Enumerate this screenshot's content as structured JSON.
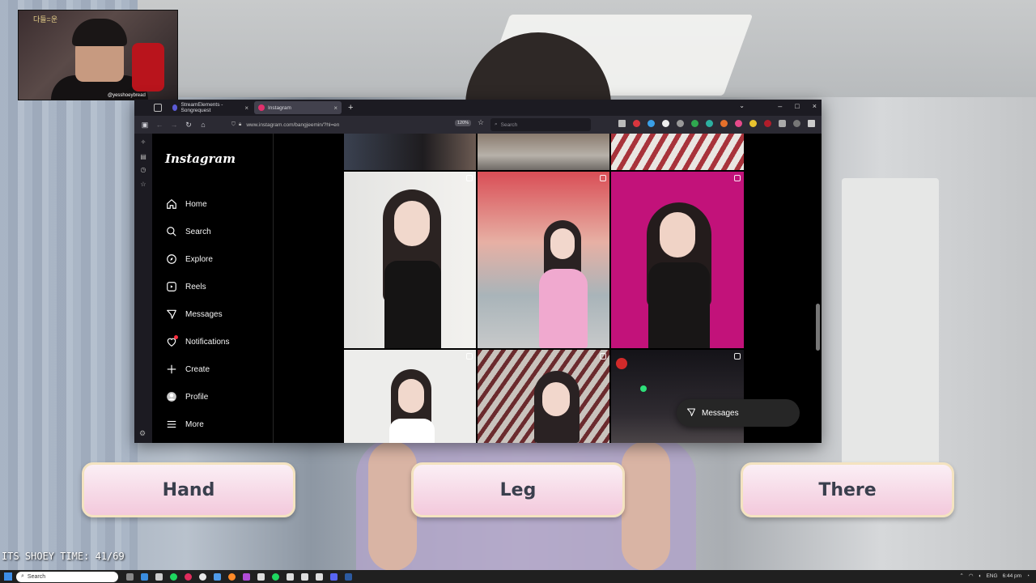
{
  "webcam": {
    "channel_logo": "다들=운",
    "handle": "@yesshoeybread"
  },
  "browser": {
    "tabs": [
      {
        "label": "StreamElements - Songrequest",
        "favicon_color": "#5b5bd6"
      },
      {
        "label": "Instagram",
        "favicon_color": "#e1306c",
        "active": true
      }
    ],
    "url": "www.instagram.com/bangjeemin/?hl=en",
    "zoom": "120%",
    "search_placeholder": "Search"
  },
  "instagram": {
    "logo": "Instagram",
    "nav": [
      {
        "label": "Home",
        "icon": "home-icon"
      },
      {
        "label": "Search",
        "icon": "search-icon"
      },
      {
        "label": "Explore",
        "icon": "compass-icon"
      },
      {
        "label": "Reels",
        "icon": "reels-icon"
      },
      {
        "label": "Messages",
        "icon": "send-icon"
      },
      {
        "label": "Notifications",
        "icon": "heart-icon"
      },
      {
        "label": "Create",
        "icon": "plus-icon"
      },
      {
        "label": "Profile",
        "icon": "avatar-icon"
      },
      {
        "label": "More",
        "icon": "menu-icon"
      }
    ],
    "floating_messages": "Messages"
  },
  "answers": [
    "Hand",
    "Leg",
    "There"
  ],
  "stream_overlay": "ITS SHOEY TIME: 41/69",
  "taskbar": {
    "search": "Search",
    "language": "ENG",
    "time": "6:44 pm"
  },
  "colors": {
    "accent_pink": "#c2127a",
    "button_gradient_top": "#fbeff5",
    "button_gradient_bottom": "#f3c9dc"
  }
}
